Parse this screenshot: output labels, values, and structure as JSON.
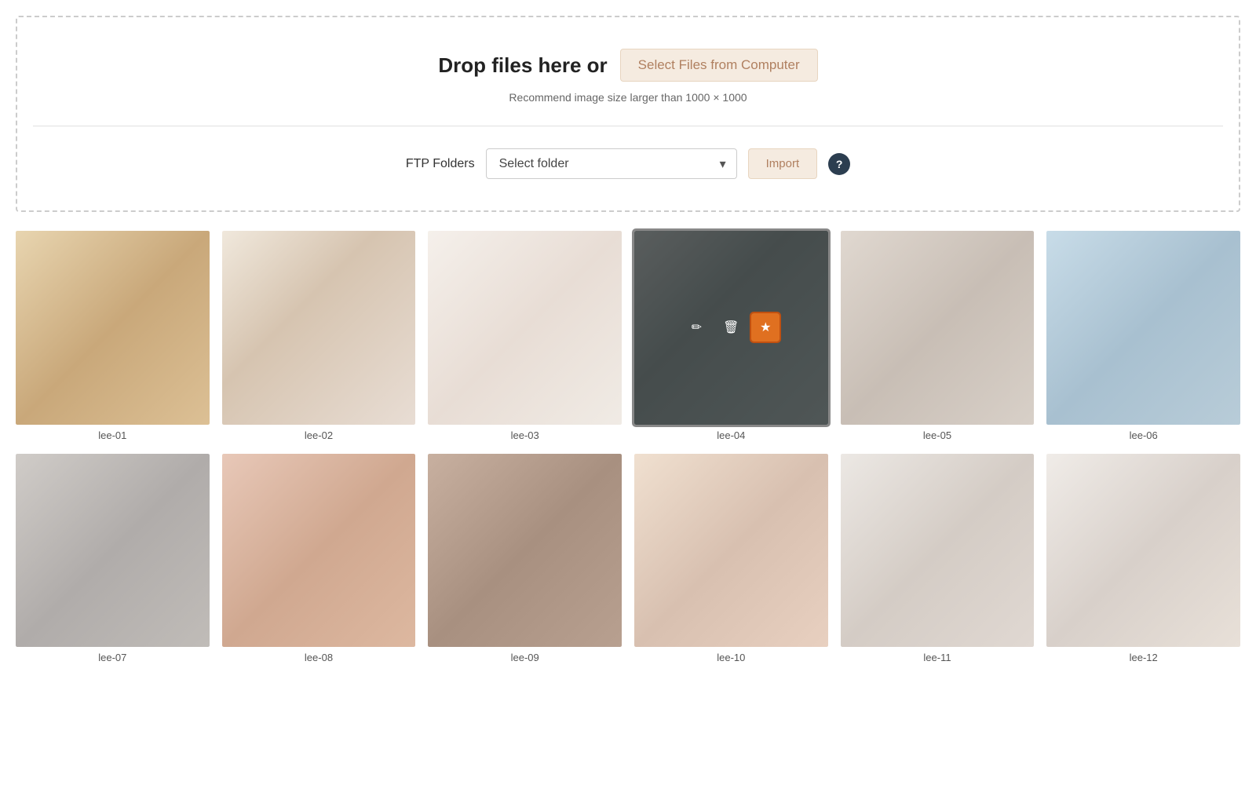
{
  "dropzone": {
    "drop_text": "Drop files here or",
    "select_files_label": "Select Files from Computer",
    "recommend_text": "Recommend image size larger than 1000 × 1000",
    "ftp_label": "FTP Folders",
    "folder_placeholder": "Select folder",
    "import_label": "Import",
    "help_label": "?"
  },
  "images": [
    {
      "id": "lee-01",
      "label": "lee-01",
      "thumb_class": "thumb-1",
      "active": false
    },
    {
      "id": "lee-02",
      "label": "lee-02",
      "thumb_class": "thumb-2",
      "active": false
    },
    {
      "id": "lee-03",
      "label": "lee-03",
      "thumb_class": "thumb-3",
      "active": false
    },
    {
      "id": "lee-04",
      "label": "lee-04",
      "thumb_class": "thumb-4",
      "active": true
    },
    {
      "id": "lee-05",
      "label": "lee-05",
      "thumb_class": "thumb-5",
      "active": false
    },
    {
      "id": "lee-06",
      "label": "lee-06",
      "thumb_class": "thumb-6",
      "active": false
    },
    {
      "id": "lee-07",
      "label": "lee-07",
      "thumb_class": "thumb-7",
      "active": false
    },
    {
      "id": "lee-08",
      "label": "lee-08",
      "thumb_class": "thumb-8",
      "active": false
    },
    {
      "id": "lee-09",
      "label": "lee-09",
      "thumb_class": "thumb-9",
      "active": false
    },
    {
      "id": "lee-10",
      "label": "lee-10",
      "thumb_class": "thumb-10",
      "active": false
    },
    {
      "id": "lee-11",
      "label": "lee-11",
      "thumb_class": "thumb-11",
      "active": false
    },
    {
      "id": "lee-12",
      "label": "lee-12",
      "thumb_class": "thumb-12",
      "active": false
    }
  ],
  "overlay_icons": {
    "edit": "✏",
    "delete": "🗑",
    "star": "★"
  }
}
